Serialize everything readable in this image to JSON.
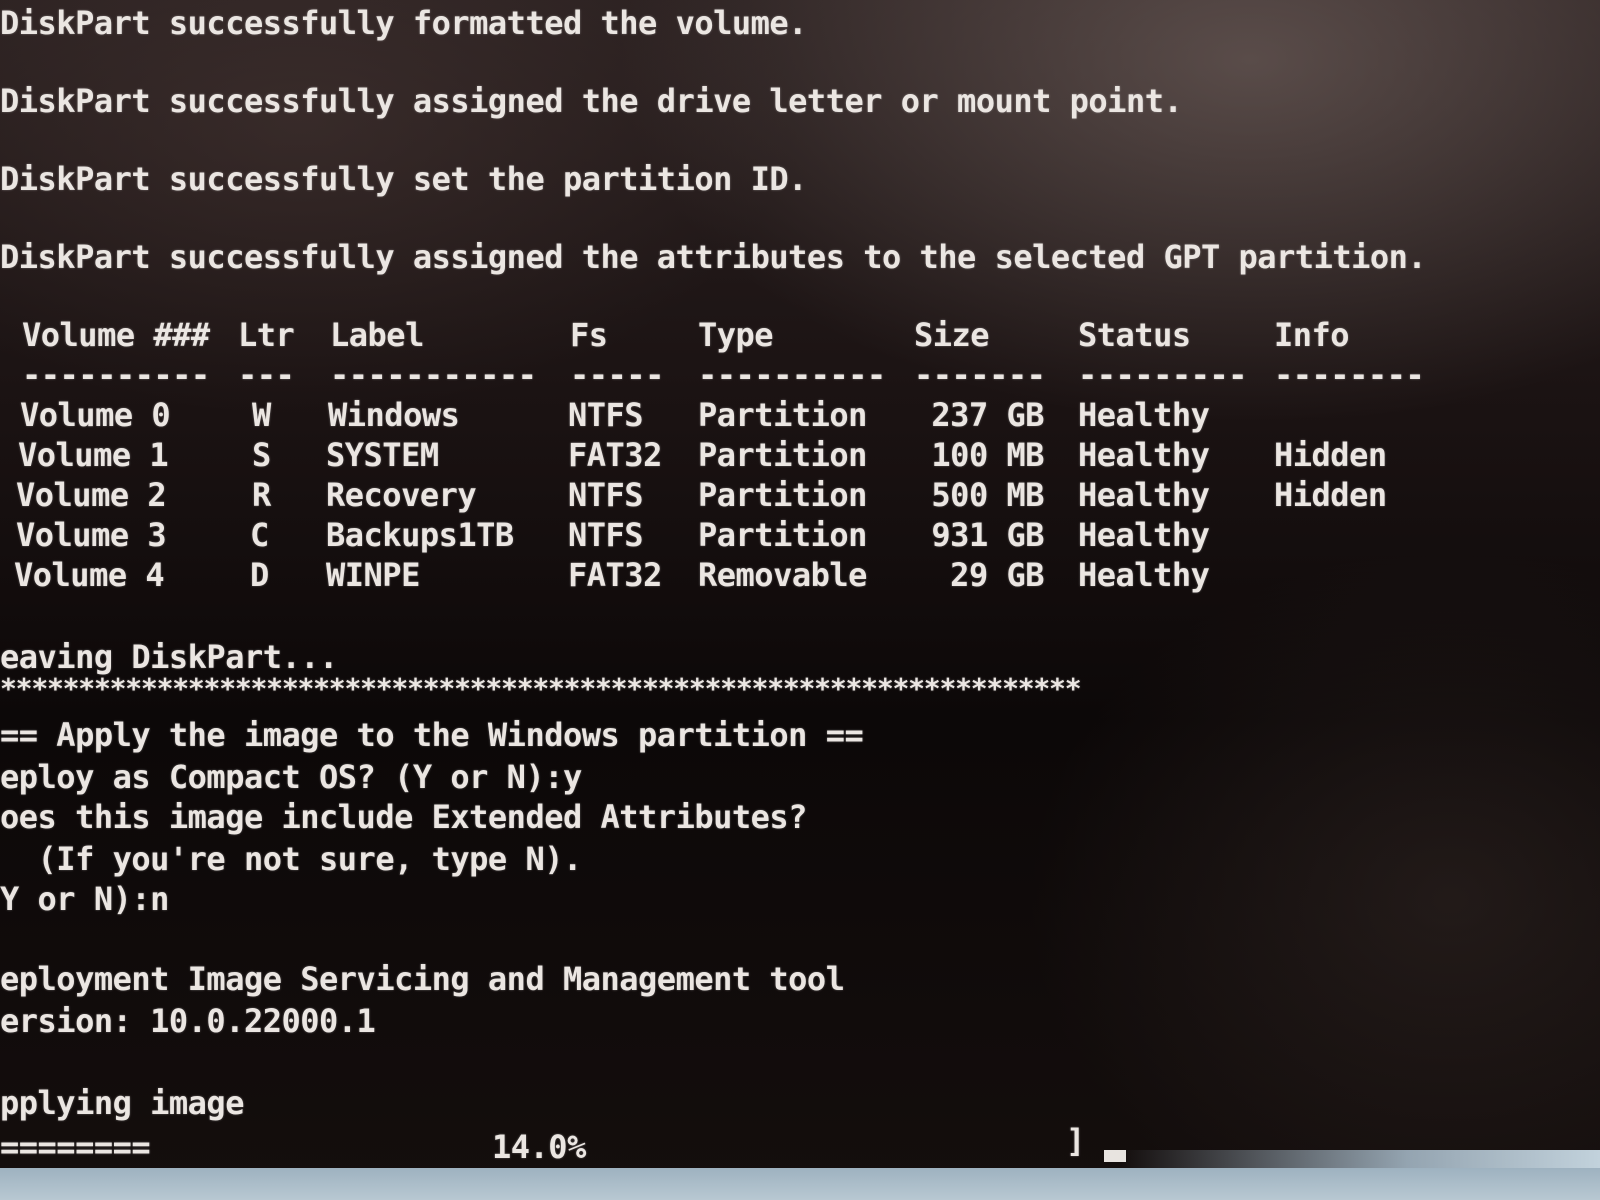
{
  "messages": [
    "DiskPart successfully formatted the volume.",
    "DiskPart successfully assigned the drive letter or mount point.",
    "DiskPart successfully set the partition ID.",
    "DiskPart successfully assigned the attributes to the selected GPT partition."
  ],
  "volume_table": {
    "headers": [
      "Volume ###",
      "Ltr",
      "Label",
      "Fs",
      "Type",
      "Size",
      "Status",
      "Info"
    ],
    "separators": [
      "----------",
      "---",
      "-----------",
      "-----",
      "----------",
      "-------",
      "---------",
      "--------"
    ],
    "rows": [
      [
        "Volume 0",
        "W",
        "Windows",
        "NTFS",
        "Partition",
        "237 GB",
        "Healthy",
        ""
      ],
      [
        "Volume 1",
        "S",
        "SYSTEM",
        "FAT32",
        "Partition",
        "100 MB",
        "Healthy",
        "Hidden"
      ],
      [
        "Volume 2",
        "R",
        "Recovery",
        "NTFS",
        "Partition",
        "500 MB",
        "Healthy",
        "Hidden"
      ],
      [
        "Volume 3",
        "C",
        "Backups1TB",
        "NTFS",
        "Partition",
        "931 GB",
        "Healthy",
        ""
      ],
      [
        "Volume 4",
        "D",
        "WINPE",
        "FAT32",
        "Removable",
        "29 GB",
        "Healthy",
        ""
      ]
    ]
  },
  "leaving": "eaving DiskPart...",
  "stars": "*********************************************************************",
  "apply_header": "== Apply the image to the Windows partition ==",
  "compact_prompt": "eploy as Compact OS? (Y or N):y",
  "ea_prompt_1": "oes this image include Extended Attributes?",
  "ea_prompt_2": "  (If you're not sure, type N).",
  "ea_prompt_3": "Y or N):n",
  "dism_title": "eployment Image Servicing and Management tool",
  "dism_version": "ersion: 10.0.22000.1",
  "applying": "pplying image",
  "progress": {
    "bar_text": "========",
    "percent_text": "14.0%",
    "fraction": 0.14,
    "end_bracket": "]"
  }
}
